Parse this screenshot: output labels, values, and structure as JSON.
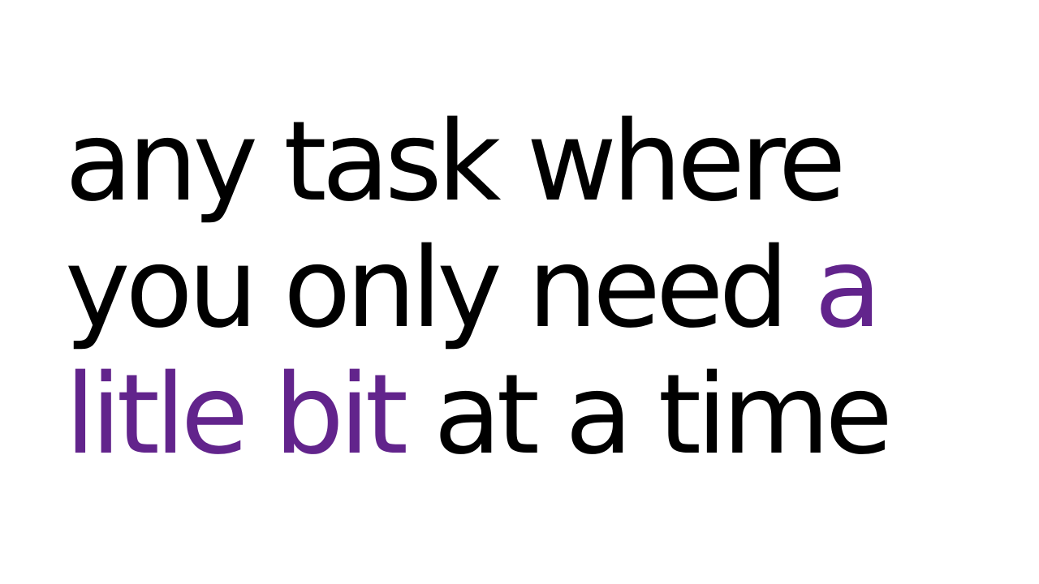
{
  "slide": {
    "lines": [
      {
        "text_before": "any task where",
        "accent": "",
        "text_after": ""
      },
      {
        "text_before": "you only need ",
        "accent": "a",
        "text_after": ""
      },
      {
        "text_before": "",
        "accent": "litle bit",
        "text_after": " at a time"
      }
    ]
  },
  "colors": {
    "background": "#ffffff",
    "text": "#000000",
    "accent": "#62248c"
  }
}
